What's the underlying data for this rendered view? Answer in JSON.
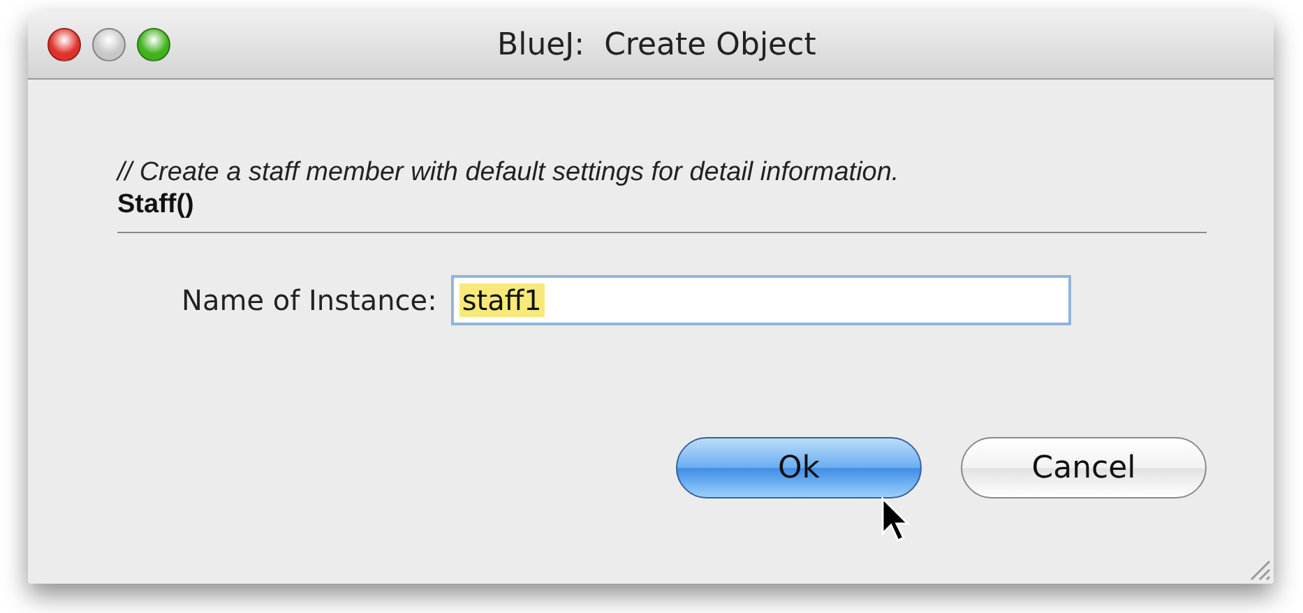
{
  "window": {
    "title": "BlueJ:  Create Object"
  },
  "description": "// Create a staff member with default settings for detail information.",
  "signature": "Staff()",
  "name_field": {
    "label": "Name of Instance:",
    "value": "staff1",
    "text_selected": true
  },
  "buttons": [
    {
      "label": "Ok",
      "default": true
    },
    {
      "label": "Cancel",
      "default": false
    }
  ]
}
